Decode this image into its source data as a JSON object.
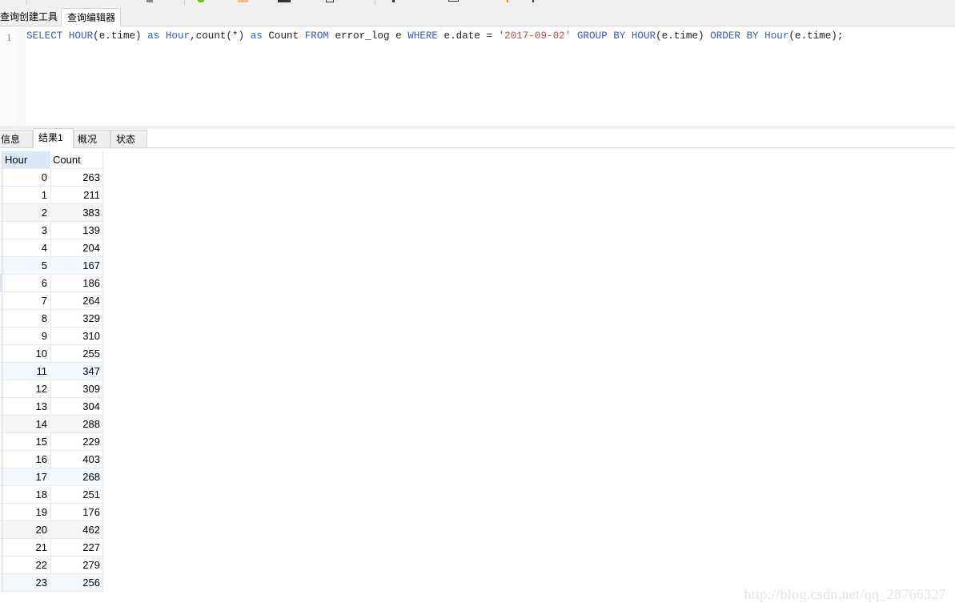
{
  "editor_tabs": [
    {
      "label": "查询创建工具",
      "active": false
    },
    {
      "label": "查询编辑器",
      "active": true
    }
  ],
  "editor": {
    "line_number": "1",
    "sql_tokens": [
      {
        "t": "SELECT",
        "k": "kw"
      },
      {
        "t": " ",
        "k": ""
      },
      {
        "t": "HOUR",
        "k": "kw"
      },
      {
        "t": "(e.time) ",
        "k": ""
      },
      {
        "t": "as",
        "k": "kw"
      },
      {
        "t": " ",
        "k": ""
      },
      {
        "t": "Hour",
        "k": "kw"
      },
      {
        "t": ",count(*) ",
        "k": ""
      },
      {
        "t": "as",
        "k": "kw"
      },
      {
        "t": " Count ",
        "k": ""
      },
      {
        "t": "FROM",
        "k": "kw"
      },
      {
        "t": " error_log e ",
        "k": ""
      },
      {
        "t": "WHERE",
        "k": "kw"
      },
      {
        "t": " e.date = ",
        "k": ""
      },
      {
        "t": "'2017-09-02'",
        "k": "str"
      },
      {
        "t": " ",
        "k": ""
      },
      {
        "t": "GROUP BY",
        "k": "kw"
      },
      {
        "t": " ",
        "k": ""
      },
      {
        "t": "HOUR",
        "k": "kw"
      },
      {
        "t": "(e.time) ",
        "k": ""
      },
      {
        "t": "ORDER BY",
        "k": "kw"
      },
      {
        "t": " ",
        "k": ""
      },
      {
        "t": "Hour",
        "k": "kw"
      },
      {
        "t": "(e.time);",
        "k": ""
      }
    ]
  },
  "result_tabs": [
    {
      "label": "信息",
      "active": false
    },
    {
      "label": "结果1",
      "active": true
    },
    {
      "label": "概况",
      "active": false
    },
    {
      "label": "状态",
      "active": false
    }
  ],
  "results": {
    "columns": [
      "Hour",
      "Count"
    ],
    "rows": [
      [
        "0",
        "263"
      ],
      [
        "1",
        "211"
      ],
      [
        "2",
        "383"
      ],
      [
        "3",
        "139"
      ],
      [
        "4",
        "204"
      ],
      [
        "5",
        "167"
      ],
      [
        "6",
        "186"
      ],
      [
        "7",
        "264"
      ],
      [
        "8",
        "329"
      ],
      [
        "9",
        "310"
      ],
      [
        "10",
        "255"
      ],
      [
        "11",
        "347"
      ],
      [
        "12",
        "309"
      ],
      [
        "13",
        "304"
      ],
      [
        "14",
        "288"
      ],
      [
        "15",
        "229"
      ],
      [
        "16",
        "403"
      ],
      [
        "17",
        "268"
      ],
      [
        "18",
        "251"
      ],
      [
        "19",
        "176"
      ],
      [
        "20",
        "462"
      ],
      [
        "21",
        "227"
      ],
      [
        "22",
        "279"
      ],
      [
        "23",
        "256"
      ]
    ]
  },
  "watermark": "http://blog.csdn.net/qq_28766327",
  "colors": {
    "keyword": "#3355ee",
    "string": "#cc4444",
    "header_selected": "#dbe9f6"
  }
}
